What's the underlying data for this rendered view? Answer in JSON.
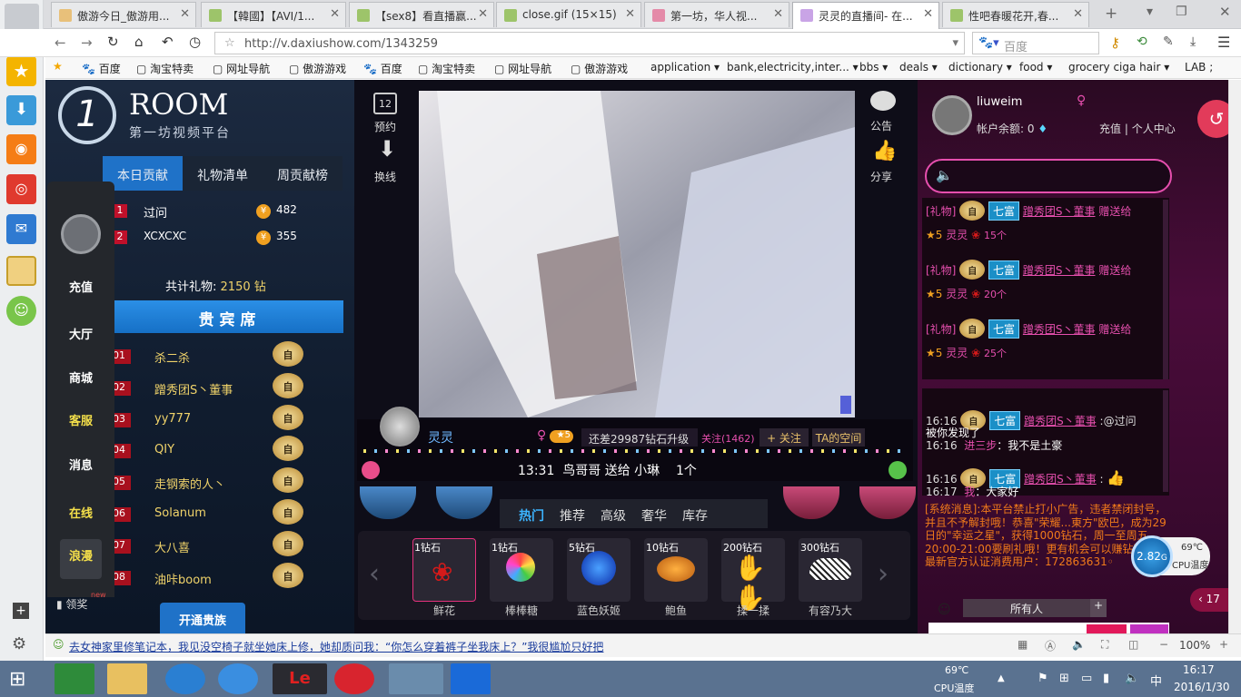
{
  "tabs": [
    {
      "label": "傲游今日_傲游用..."
    },
    {
      "label": "【韓國】【AVI/1..."
    },
    {
      "label": "【sex8】看直播赢..."
    },
    {
      "label": "close.gif (15×15)"
    },
    {
      "label": "第一坊，华人视..."
    },
    {
      "label": "灵灵的直播间- 在..."
    },
    {
      "label": "性吧春暖花开,春..."
    }
  ],
  "navbar": {
    "url": "http://v.daxiushow.com/1343259",
    "search_placeholder": "百度"
  },
  "bookmarks": [
    "百度",
    "淘宝特卖",
    "网址导航",
    "傲游游戏",
    "百度",
    "淘宝特卖",
    "网址导航",
    "傲游游戏",
    "application ▾",
    "bank,electricity,inter... ▾",
    "bbs ▾",
    "deals ▾",
    "dictionary ▾",
    "food ▾",
    "grocery ciga hair ▾",
    "LAB ;"
  ],
  "site": {
    "logo_title": "ROOM",
    "logo_sub": "第一坊视频平台"
  },
  "left_tabs": [
    "本日贡献",
    "礼物清单",
    "周贡献榜"
  ],
  "contrib": [
    {
      "no": "1",
      "name": "过问",
      "value": "482"
    },
    {
      "no": "2",
      "name": "XCXCXC",
      "value": "355"
    }
  ],
  "total_gift_label": "共计礼物:",
  "total_gift_value": "2150 钻",
  "vip_title": "贵 宾 席",
  "vip_list": [
    {
      "no": "01",
      "name": "杀二杀"
    },
    {
      "no": "02",
      "name": "蹭秀团S丶董事"
    },
    {
      "no": "03",
      "name": "yy777"
    },
    {
      "no": "04",
      "name": "QIY"
    },
    {
      "no": "05",
      "name": "走钢索的人丶"
    },
    {
      "no": "06",
      "name": "Solanum"
    },
    {
      "no": "07",
      "name": "大八喜"
    },
    {
      "no": "08",
      "name": "油咔boom"
    }
  ],
  "badge_text": "自",
  "open_vip": "开通贵族",
  "sidemenu": [
    "充值",
    "大厅",
    "商城",
    "客服",
    "消息",
    "在线",
    "浪漫"
  ],
  "reward_label": "领奖",
  "reward_new": "new",
  "center_top": {
    "reserve": "预约",
    "reserve_day": "12",
    "switch_line": "换线",
    "notice": "公告",
    "share": "分享"
  },
  "streamer": {
    "name": "灵灵",
    "upgrade": "还差29987钻石升级",
    "follow_count": "关注(1462)",
    "follow_btn": "+ 关注",
    "space": "TA的空间"
  },
  "marquee": {
    "time": "13:31",
    "from": "鸟哥哥",
    "send": "送给",
    "to": "小琳",
    "count": "1个"
  },
  "gift_tabs": [
    "热门",
    "推荐",
    "高级",
    "奢华",
    "库存"
  ],
  "gifts": [
    {
      "price": "1钻石",
      "name": "鲜花"
    },
    {
      "price": "1钻石",
      "name": "棒棒糖"
    },
    {
      "price": "5钻石",
      "name": "蓝色妖姬"
    },
    {
      "price": "10钻石",
      "name": "鲍鱼"
    },
    {
      "price": "200钻石",
      "name": "揉一揉"
    },
    {
      "price": "300钻石",
      "name": "有容乃大"
    }
  ],
  "user": {
    "name": "liuweim",
    "balance": "帐户余额: 0",
    "recharge": "充值",
    "center": "个人中心"
  },
  "chat_top": [
    {
      "tag": "[礼物]",
      "rank": "七富",
      "user": "蹭秀团S丶董事",
      "act": "赠送给",
      "to": "灵灵",
      "count": "15个"
    },
    {
      "tag": "[礼物]",
      "rank": "七富",
      "user": "蹭秀团S丶董事",
      "act": "赠送给",
      "to": "灵灵",
      "count": "20个"
    },
    {
      "tag": "[礼物]",
      "rank": "七富",
      "user": "蹭秀团S丶董事",
      "act": "赠送给",
      "to": "灵灵",
      "count": "25个"
    }
  ],
  "chat_bottom": [
    {
      "time": "16:16",
      "rank": "七富",
      "user": "蹭秀团S丶董事",
      "msg": ":@过问"
    },
    {
      "time": "",
      "rank": "",
      "user": "",
      "msg": "被你发现了"
    },
    {
      "time": "16:16",
      "rank": "",
      "user": "进三步",
      "msg": "：我不是土豪"
    },
    {
      "time": "16:16",
      "rank": "七富",
      "user": "蹭秀团S丶董事",
      "msg": ":"
    },
    {
      "time": "16:17",
      "rank": "",
      "user": "我",
      "msg": "：大家好"
    }
  ],
  "system_msg": "[系统消息]:本平台禁止打小广告，违者禁闭封号，并且不予解封哦！恭喜\"荣耀...東方\"欧巴，成为29日的\"幸运之星\"，获得1000钻石，周一至周五20:00-21:00要刷礼哦！更有机会可以赚钻石哟！最新官方认证消费用户：172863631◦",
  "recipient": "所有人",
  "side_count": "17",
  "cpu_widget": {
    "value": "2.82",
    "unit": "G",
    "temp": "69℃",
    "label": "CPU温度"
  },
  "statusbar": {
    "news": "去女神家里修笔记本，我见没空椅子就坐她床上修，她却质问我：“你怎么穿着裤子坐我床上？”我很尴尬只好把",
    "zoom": "100%"
  },
  "taskbar": {
    "temp": "69℃",
    "temp_label": "CPU温度",
    "ime": "中",
    "time": "16:17",
    "date": "2016/1/30"
  }
}
